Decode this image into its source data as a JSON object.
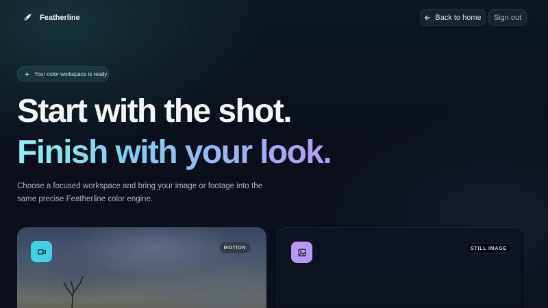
{
  "brand": {
    "name": "Featherline",
    "icon": "feather-icon"
  },
  "nav": {
    "back_label": "Back to home",
    "back_icon": "arrow-left-icon",
    "signout_label": "Sign out"
  },
  "badge": {
    "icon": "sparkle-icon",
    "text": "Your color workspace is ready"
  },
  "hero": {
    "line1": "Start with the shot.",
    "line2": "Finish with your look.",
    "lede": "Choose a focused workspace and bring your image or footage into the same precise Featherline color engine."
  },
  "cards": [
    {
      "tag": "MOTION",
      "icon": "video-icon",
      "accent": "#3fd3e8"
    },
    {
      "tag": "STILL IMAGE",
      "icon": "image-icon",
      "accent": "#b69af0"
    }
  ],
  "colors": {
    "background": "#0a0f1a",
    "gradient_start": "#8ef2f0",
    "gradient_end": "#b59af2"
  }
}
